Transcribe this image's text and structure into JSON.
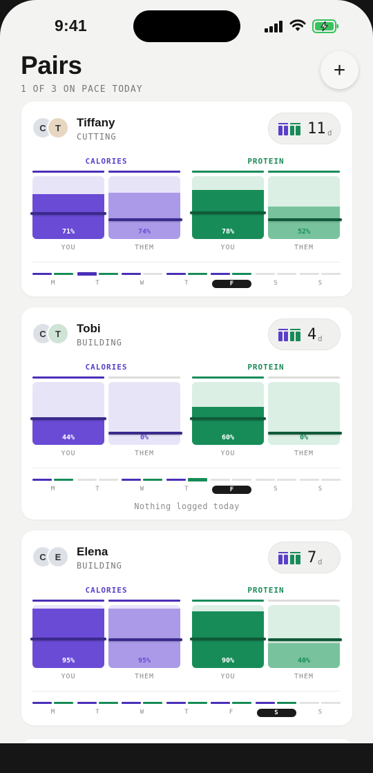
{
  "status_bar": {
    "time": "9:41"
  },
  "header": {
    "title": "Pairs",
    "subtitle": "1 OF 3 ON PACE TODAY",
    "add_icon": "plus-icon",
    "add_label": "+"
  },
  "colors": {
    "calories": "#6a4bd6",
    "protein": "#178c58",
    "today": "#1a1a1a"
  },
  "week_days": [
    "M",
    "T",
    "W",
    "T",
    "F",
    "S",
    "S"
  ],
  "labels": {
    "calories": "CALORIES",
    "protein": "PROTEIN",
    "you": "YOU",
    "them": "THEM"
  },
  "pairs": [
    {
      "name": "Tiffany",
      "mode": "CUTTING",
      "initials": [
        "C",
        "T"
      ],
      "streak": "11",
      "streak_unit": "d",
      "calories": {
        "you": "71%",
        "them": "74%",
        "you_value": 71,
        "them_value": 74
      },
      "protein": {
        "you": "78%",
        "them": "52%",
        "you_value": 78,
        "them_value": 52
      },
      "today_index": 4,
      "note": ""
    },
    {
      "name": "Tobi",
      "mode": "BUILDING",
      "initials": [
        "C",
        "T"
      ],
      "streak": "4",
      "streak_unit": "d",
      "calories": {
        "you": "44%",
        "them": "0%",
        "you_value": 44,
        "them_value": 0
      },
      "protein": {
        "you": "60%",
        "them": "0%",
        "you_value": 60,
        "them_value": 0
      },
      "today_index": 4,
      "note": "Nothing logged today"
    },
    {
      "name": "Elena",
      "mode": "BUILDING",
      "initials": [
        "C",
        "E"
      ],
      "streak": "7",
      "streak_unit": "d",
      "calories": {
        "you": "95%",
        "them": "95%",
        "you_value": 95,
        "them_value": 95
      },
      "protein": {
        "you": "90%",
        "them": "40%",
        "you_value": 90,
        "them_value": 40
      },
      "today_index": 5,
      "note": ""
    }
  ]
}
